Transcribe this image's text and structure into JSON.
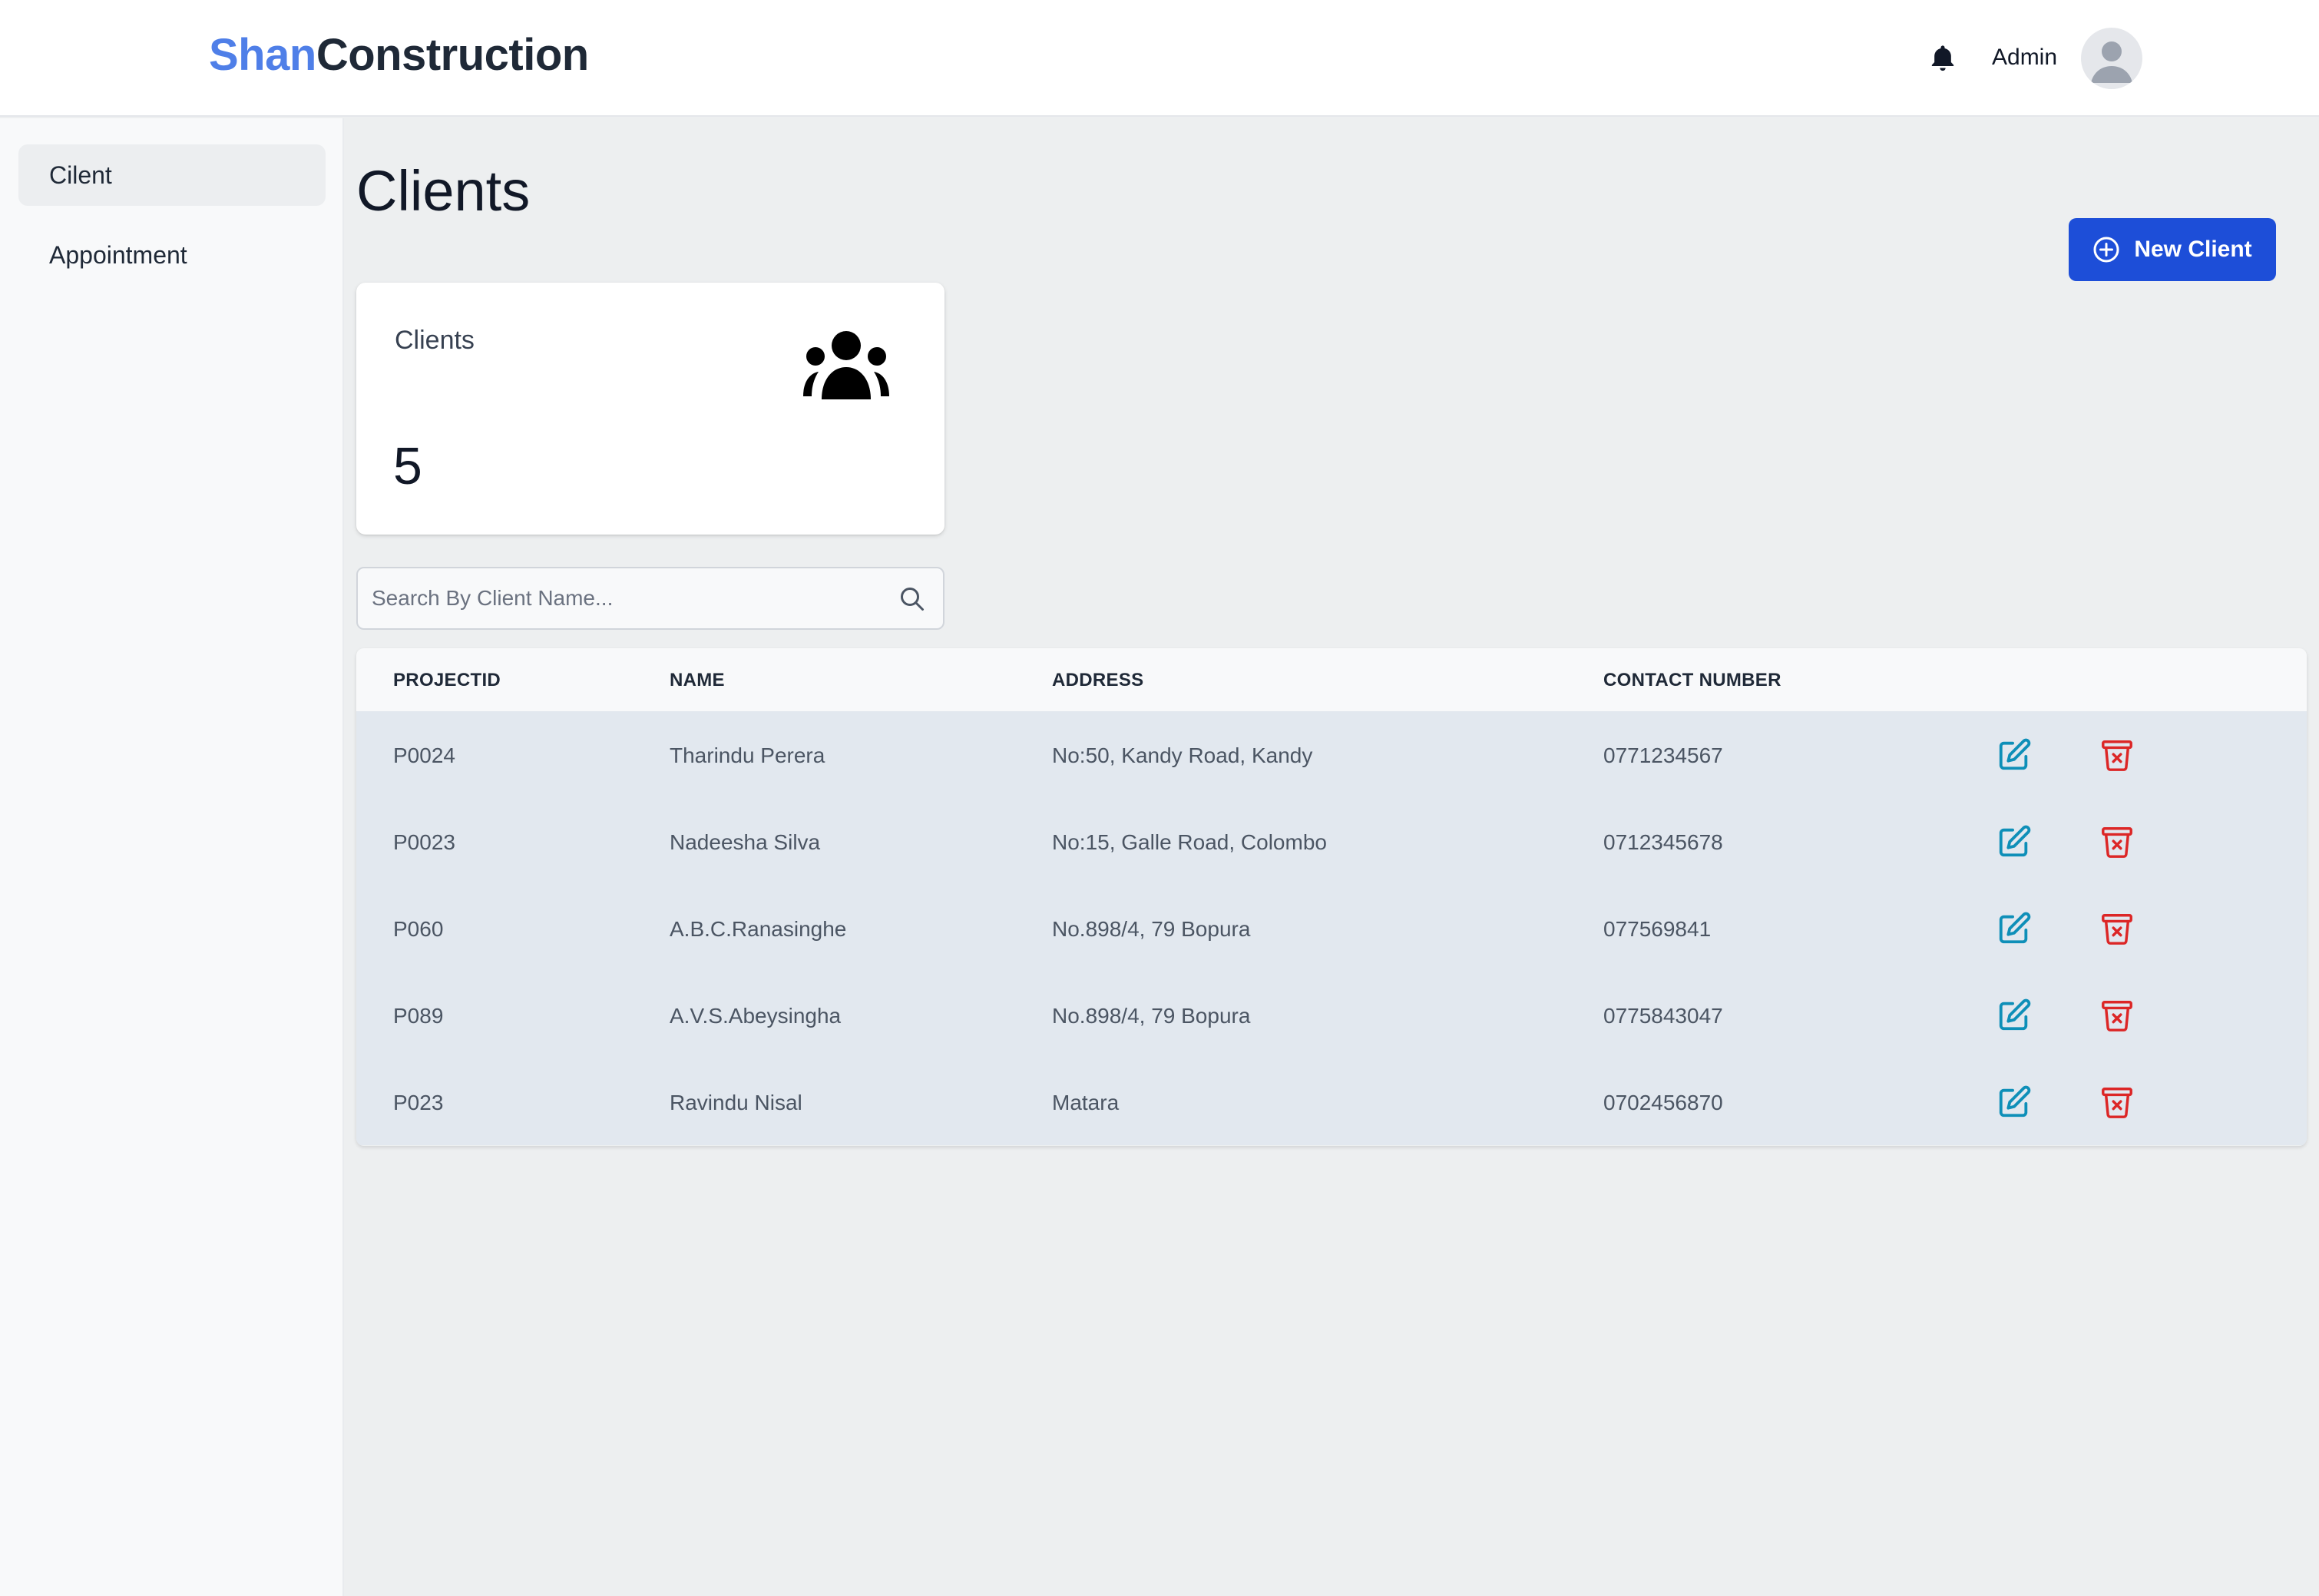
{
  "header": {
    "brand_part1": "Shan",
    "brand_part2": "Construction",
    "user_label": "Admin"
  },
  "sidebar": {
    "items": [
      {
        "label": "Cilent"
      },
      {
        "label": "Appointment"
      }
    ]
  },
  "main": {
    "title": "Clients",
    "new_button_label": "New Client",
    "stat_card": {
      "label": "Clients",
      "value": "5"
    },
    "search": {
      "placeholder": "Search By Client Name...",
      "value": ""
    }
  },
  "table": {
    "columns": [
      "PROJECTID",
      "NAME",
      "ADDRESS",
      "CONTACT NUMBER"
    ],
    "rows": [
      {
        "project_id": "P0024",
        "name": "Tharindu Perera",
        "address": "No:50, Kandy Road, Kandy",
        "contact": "0771234567"
      },
      {
        "project_id": "P0023",
        "name": "Nadeesha Silva",
        "address": "No:15, Galle Road, Colombo",
        "contact": "0712345678"
      },
      {
        "project_id": "P060",
        "name": "A.B.C.Ranasinghe",
        "address": "No.898/4, 79 Bopura",
        "contact": "077569841"
      },
      {
        "project_id": "P089",
        "name": "A.V.S.Abeysingha",
        "address": "No.898/4, 79 Bopura",
        "contact": "0775843047"
      },
      {
        "project_id": "P023",
        "name": "Ravindu Nisal",
        "address": "Matara",
        "contact": "0702456870"
      }
    ]
  },
  "colors": {
    "brand_accent": "#4f7fe8",
    "primary_button": "#1d4ed8",
    "edit_icon": "#0e8fb8",
    "delete_icon": "#dc2626",
    "row_background": "#e2e8ef"
  },
  "icons": {
    "notification": "bell-icon",
    "user": "user-avatar-icon",
    "new": "plus-circle-icon",
    "stat": "users-group-icon",
    "search": "search-icon",
    "edit": "edit-icon",
    "delete": "trash-icon"
  }
}
